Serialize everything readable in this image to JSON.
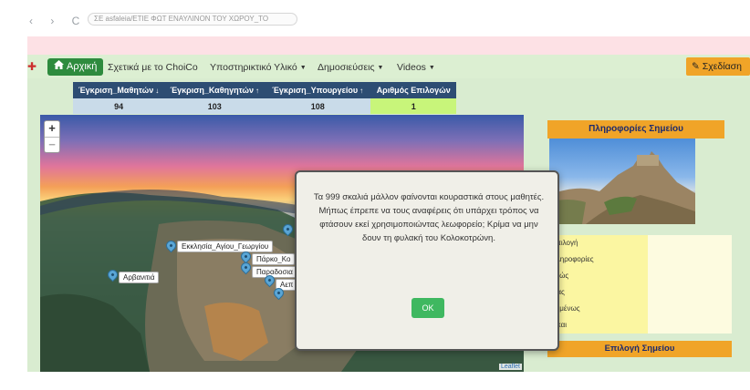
{
  "browser": {
    "nav_glyphs": "‹ › C",
    "url": "ΣΕ asfaleia/ΕΤΙΕ ΦΩΤ ΕΝΑΥΛΙΝΟΝ ΤΟΥ ΧΩΡΟΥ_ΤΟ"
  },
  "navbar": {
    "home_label": "Αρχική",
    "items": [
      {
        "label": "Σχετικά με το ChoiCo",
        "has_caret": false
      },
      {
        "label": "Υποστηρικτικό Υλικό",
        "has_caret": true
      },
      {
        "label": "Δημοσιεύσεις",
        "has_caret": true
      },
      {
        "label": "Videos",
        "has_caret": true
      }
    ],
    "design_label": "Σχεδίαση"
  },
  "stats": {
    "headers": [
      "Έγκριση_Μαθητών",
      "Έγκριση_Καθηγητών",
      "Έγκριση_Υπουργείου",
      "Αριθμός Επιλογών"
    ],
    "values": [
      "94",
      "103",
      "108",
      "1"
    ]
  },
  "map": {
    "zoom_in": "+",
    "zoom_out": "−",
    "markers": [
      {
        "label": "Εκκλησία_Αγίου_Γεωργίου"
      },
      {
        "label": "Πάρκο_Κο"
      },
      {
        "label": "Παραδοσια"
      },
      {
        "label": "Αρβανιτιά"
      },
      {
        "label": "Αεπ"
      }
    ],
    "attribution": "Leaflet"
  },
  "info_panel": {
    "title": "Πληροφορίες Σημείου",
    "rows": [
      "Επιλογή",
      "Πληροφορίες",
      "αθώς",
      "αιας",
      "τωμένως",
      "ή και"
    ],
    "select_button": "Επιλογή Σημείου"
  },
  "modal": {
    "text": "Τα 999 σκαλιά μάλλον φαίνονται κουραστικά στους μαθητές. Μήπως έπρεπε να τους αναφέρεις ότι υπάρχει τρόπος να φτάσουν εκεί χρησιμοποιώντας λεωφορείο; Κρίμα να μην δουν τη φυλακή του Κολοκοτρώνη.",
    "ok_label": "OK"
  },
  "colors": {
    "accent_green": "#2e8b3e",
    "accent_orange": "#f0a428",
    "table_header": "#2d4d73",
    "highlight": "#c8f57a"
  }
}
